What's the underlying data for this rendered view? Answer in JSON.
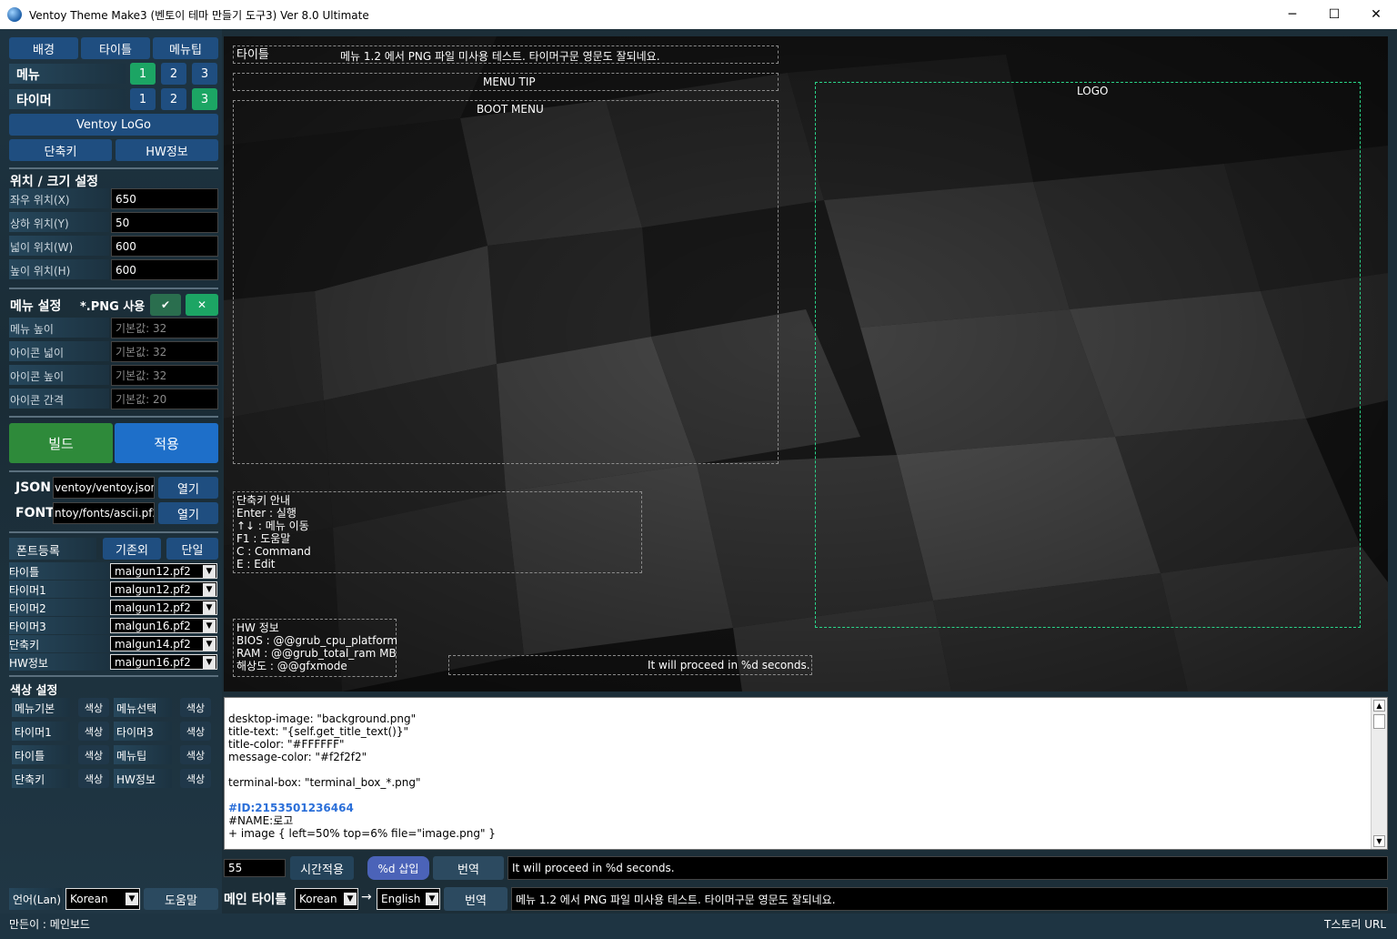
{
  "window": {
    "title": "Ventoy Theme Make3 (벤토이 테마 만들기 도구3)  Ver 8.0 Ultimate",
    "controls": [
      "─",
      "☐",
      "✕"
    ]
  },
  "sidebar": {
    "tabs": [
      "배경",
      "타이틀",
      "메뉴팁"
    ],
    "menu_label": "메뉴",
    "menu_options": [
      "1",
      "2",
      "3"
    ],
    "timer_label": "타이머",
    "timer_options": [
      "1",
      "2",
      "3"
    ],
    "logo_button": "Ventoy LoGo",
    "shortcut_button": "단축키",
    "hw_button": "HW정보",
    "position_title": "위치 / 크기 설정",
    "position_fields": [
      {
        "label": "좌우 위치(X)",
        "value": "650"
      },
      {
        "label": "상하 위치(Y)",
        "value": "50"
      },
      {
        "label": "넓이 위치(W)",
        "value": "600"
      },
      {
        "label": "높이 위치(H)",
        "value": "600"
      }
    ],
    "menu_settings_title": "메뉴 설정",
    "png_use_label": "*.PNG 사용",
    "png_check": "✔",
    "png_cross": "✕",
    "menu_fields": [
      {
        "label": "메뉴 높이",
        "placeholder": "기본값: 32"
      },
      {
        "label": "아이콘 넓이",
        "placeholder": "기본값: 32"
      },
      {
        "label": "아이콘 높이",
        "placeholder": "기본값: 32"
      },
      {
        "label": "아이콘 간격",
        "placeholder": "기본값: 20"
      }
    ],
    "build_button": "빌드",
    "apply_button": "적용",
    "json_label": "JSON",
    "json_path": "ventoy/ventoy.json",
    "json_open": "열기",
    "font_label": "FONT",
    "font_path": "ntoy/fonts/ascii.pf2",
    "font_open": "열기",
    "font_register": "폰트등록",
    "font_basic": "기존외",
    "font_single": "단일",
    "font_rows": [
      {
        "label": "타이틀",
        "value": "malgun12.pf2"
      },
      {
        "label": "타이머1",
        "value": "malgun12.pf2"
      },
      {
        "label": "타이머2",
        "value": "malgun12.pf2"
      },
      {
        "label": "타이머3",
        "value": "malgun16.pf2"
      },
      {
        "label": "단축키",
        "value": "malgun14.pf2"
      },
      {
        "label": "HW정보",
        "value": "malgun16.pf2"
      }
    ],
    "color_title": "색상 설정",
    "color_rows": [
      {
        "left": "메뉴기본",
        "right": "메뉴선택"
      },
      {
        "left": "타이머1",
        "right": "타이머3"
      },
      {
        "left": "타이틀",
        "right": "메뉴팁"
      },
      {
        "left": "단축키",
        "right": "HW정보"
      }
    ],
    "color_button": "색상",
    "lang_label": "언어(Lan)",
    "lang_value": "Korean",
    "help_button": "도움말"
  },
  "preview": {
    "title_label": "타이틀",
    "title_text": "메뉴 1.2 에서 PNG 파일 미사용 테스트. 타이머구문 영문도 잘되네요.",
    "menu_tip": "MENU TIP",
    "boot_menu": "BOOT MENU",
    "logo": "LOGO",
    "shortcut_lines": [
      "단축키 안내",
      "Enter : 실행",
      "↑↓ : 메뉴 이동",
      "F1 : 도움말",
      "C : Command",
      "E : Edit"
    ],
    "hw_lines": [
      "HW 정보",
      "BIOS : @@grub_cpu_platform",
      "RAM : @@grub_total_ram MB",
      "해상도 : @@gfxmode"
    ],
    "timer_text": "It will proceed in %d seconds."
  },
  "editor": {
    "lines": [
      "",
      "desktop-image: \"background.png\"",
      "title-text: \"{self.get_title_text()}\"",
      "title-color: \"#FFFFFF\"",
      "message-color: \"#f2f2f2\"",
      "",
      "terminal-box: \"terminal_box_*.png\"",
      "",
      "#ID:2153501236464",
      "#NAME:로고",
      "+ image { left=50% top=6% file=\"image.png\" }"
    ]
  },
  "timer_bar": {
    "seconds": "55",
    "apply_time": "시간적용",
    "insert_d": "%d 삽입",
    "translate": "번역",
    "text": "It will proceed in %d seconds."
  },
  "title_bar": {
    "label": "메인 타이틀",
    "from_lang": "Korean",
    "arrow": "→",
    "to_lang": "English",
    "translate": "번역",
    "text": "메뉴 1.2 에서 PNG 파일 미사용 테스트. 타이머구문 영문도 잘되네요."
  },
  "status": {
    "author": "만든이 : 메인보드",
    "url": "T스토리 URL"
  },
  "colors": {
    "accent_blue": "#1f4e80",
    "accent_green": "#1ca564",
    "logo_border": "#2ad68a"
  }
}
